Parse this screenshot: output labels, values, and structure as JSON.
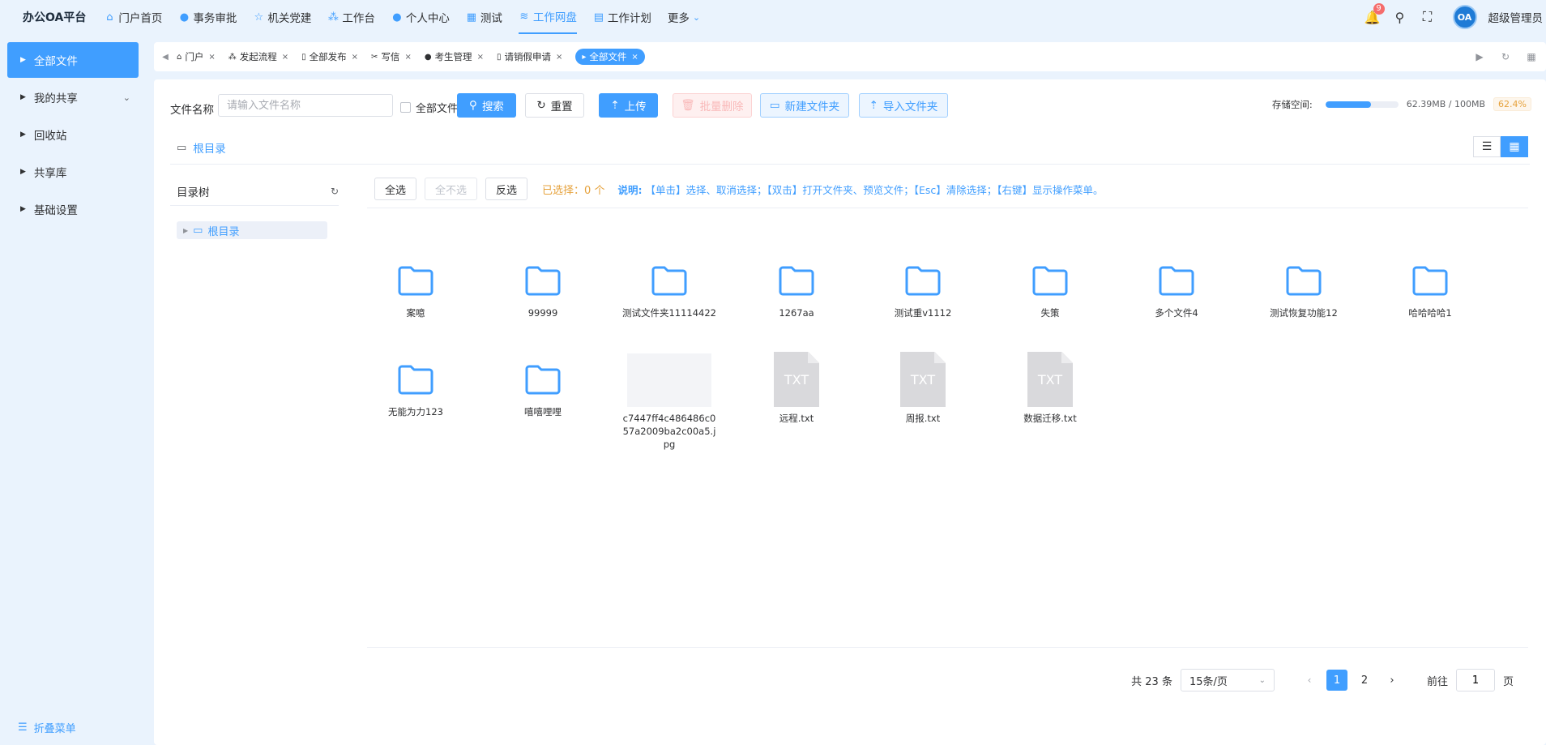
{
  "app": {
    "title": "办公OA平台"
  },
  "topnav": [
    {
      "label": "门户首页",
      "icon": "home-icon"
    },
    {
      "label": "事务审批",
      "icon": "info-icon"
    },
    {
      "label": "机关党建",
      "icon": "star-icon"
    },
    {
      "label": "工作台",
      "icon": "sitemap-icon"
    },
    {
      "label": "个人中心",
      "icon": "user-icon"
    },
    {
      "label": "测试",
      "icon": "grid-icon"
    },
    {
      "label": "工作网盘",
      "icon": "database-icon",
      "active": true
    },
    {
      "label": "工作计划",
      "icon": "calendar-icon"
    },
    {
      "label": "更多",
      "icon": "chevron-down-icon"
    }
  ],
  "header_right": {
    "notification_count": "9",
    "avatar_text": "OA",
    "username": "超级管理员"
  },
  "sidebar": {
    "items": [
      {
        "label": "全部文件",
        "active": true
      },
      {
        "label": "我的共享",
        "expandable": true
      },
      {
        "label": "回收站"
      },
      {
        "label": "共享库"
      },
      {
        "label": "基础设置"
      }
    ],
    "collapse_label": "折叠菜单"
  },
  "tabs": [
    {
      "label": "门户",
      "icon": "home-icon"
    },
    {
      "label": "发起流程",
      "icon": "sitemap-icon"
    },
    {
      "label": "全部发布",
      "icon": "document-icon"
    },
    {
      "label": "写信",
      "icon": "tools-icon"
    },
    {
      "label": "考生管理",
      "icon": "user-icon"
    },
    {
      "label": "请销假申请",
      "icon": "document-icon"
    },
    {
      "label": "全部文件",
      "icon": "play-icon",
      "active": true
    }
  ],
  "toolbar": {
    "filename_label": "文件名称",
    "filename_placeholder": "请输入文件名称",
    "all_files_label": "全部文件",
    "search_label": "搜索",
    "reset_label": "重置",
    "upload_label": "上传",
    "batch_delete_label": "批量删除",
    "new_folder_label": "新建文件夹",
    "import_folder_label": "导入文件夹"
  },
  "storage": {
    "label": "存储空间:",
    "used_text": "62.39MB / 100MB",
    "percent_text": "62.4%",
    "fraction": 0.624
  },
  "breadcrumb": {
    "root": "根目录"
  },
  "tree": {
    "title": "目录树",
    "root": "根目录"
  },
  "selection": {
    "select_all": "全选",
    "select_none": "全不选",
    "invert": "反选",
    "selected_text": "已选择：0 个",
    "hint_title": "说明:",
    "hint_text": "【单击】选择、取消选择；【双击】打开文件夹、预览文件；【Esc】清除选择；【右键】显示操作菜单。"
  },
  "files": [
    {
      "name": "案噫",
      "type": "folder"
    },
    {
      "name": "99999",
      "type": "folder"
    },
    {
      "name": "测试文件夹11114422",
      "type": "folder"
    },
    {
      "name": "1267aa",
      "type": "folder"
    },
    {
      "name": "测试重v1112",
      "type": "folder"
    },
    {
      "name": "失策",
      "type": "folder"
    },
    {
      "name": "多个文件4",
      "type": "folder"
    },
    {
      "name": "测试恢复功能12",
      "type": "folder"
    },
    {
      "name": "哈哈哈哈1",
      "type": "folder"
    },
    {
      "name": "无能为力123",
      "type": "folder"
    },
    {
      "name": "嘻嘻哩哩",
      "type": "folder"
    },
    {
      "name": "c7447ff4c486486c057a2009ba2c00a5.jpg",
      "type": "image"
    },
    {
      "name": "远程.txt",
      "type": "txt",
      "badge": "TXT"
    },
    {
      "name": "周报.txt",
      "type": "txt",
      "badge": "TXT"
    },
    {
      "name": "数据迁移.txt",
      "type": "txt",
      "badge": "TXT"
    }
  ],
  "pagination": {
    "total_text": "共 23 条",
    "page_size": "15条/页",
    "pages": [
      "1",
      "2"
    ],
    "current": "1",
    "goto_label": "前往",
    "goto_value": "1",
    "page_suffix": "页"
  },
  "colors": {
    "primary": "#409eff",
    "background": "#eaf3fd",
    "warning": "#e6a23c",
    "danger": "#f56c6c"
  }
}
